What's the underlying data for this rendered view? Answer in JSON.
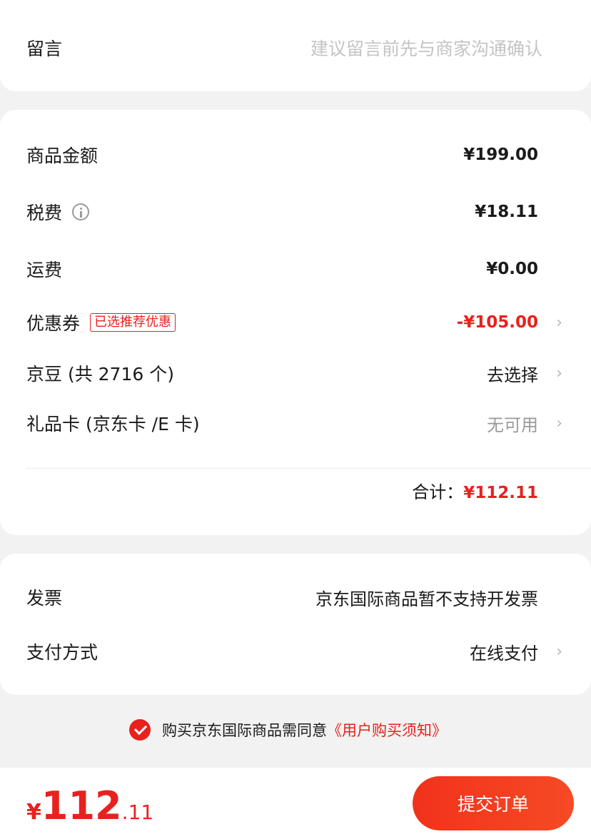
{
  "memo": {
    "label": "留言",
    "placeholder": "建议留言前先与商家沟通确认"
  },
  "cost": {
    "goods_amount": {
      "label": "商品金额",
      "value": "¥199.00"
    },
    "tax": {
      "label": "税费",
      "icon": "info-icon",
      "value": "¥18.11"
    },
    "shipping": {
      "label": "运费",
      "value": "¥0.00"
    },
    "coupon": {
      "label": "优惠券",
      "tag": "已选推荐优惠",
      "value": "-¥105.00"
    },
    "jingdou": {
      "label": "京豆 (共 2716 个)",
      "value": "去选择"
    },
    "giftcard": {
      "label": "礼品卡 (京东卡 /E 卡)",
      "value": "无可用"
    },
    "total_label": "合计：",
    "total_value": "¥112.11",
    "chevron": "›"
  },
  "invoice": {
    "label": "发票",
    "value": "京东国际商品暂不支持开发票"
  },
  "payment": {
    "label": "支付方式",
    "value": "在线支付"
  },
  "agreement": {
    "checked": true,
    "text": "购买京东国际商品需同意",
    "link": "《用户购买须知》"
  },
  "footer": {
    "currency": "¥",
    "price_int": "112",
    "price_dec": ".11",
    "submit_label": "提交订单"
  },
  "colors": {
    "accent": "#e8211e",
    "background": "#f2f2f2",
    "card": "#ffffff"
  }
}
